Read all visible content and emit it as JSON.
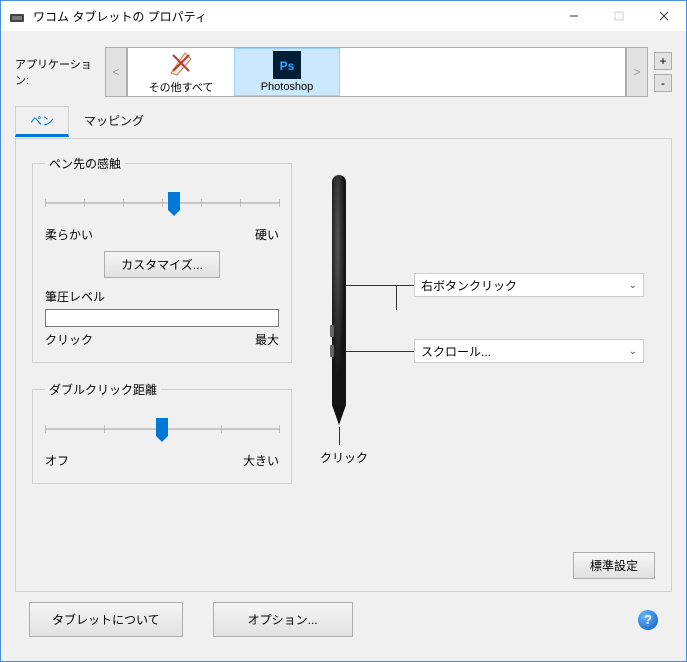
{
  "window": {
    "title": "ワコム タブレットの プロパティ"
  },
  "apps": {
    "label": "アプリケーション:",
    "items": [
      {
        "name": "その他すべて",
        "selected": false
      },
      {
        "name": "Photoshop",
        "selected": true
      }
    ]
  },
  "tabs": {
    "pen": "ペン",
    "mapping": "マッピング"
  },
  "penTip": {
    "legend": "ペン先の感触",
    "soft": "柔らかい",
    "hard": "硬い",
    "customize": "カスタマイズ...",
    "pressureLabel": "筆圧レベル",
    "clickLabel": "クリック",
    "maxLabel": "最大"
  },
  "doubleClick": {
    "legend": "ダブルクリック距離",
    "off": "オフ",
    "large": "大きい"
  },
  "pen": {
    "upperBtn": "右ボタンクリック",
    "lowerBtn": "スクロール...",
    "tipLabel": "クリック"
  },
  "buttons": {
    "default": "標準設定",
    "about": "タブレットについて",
    "options": "オプション..."
  }
}
